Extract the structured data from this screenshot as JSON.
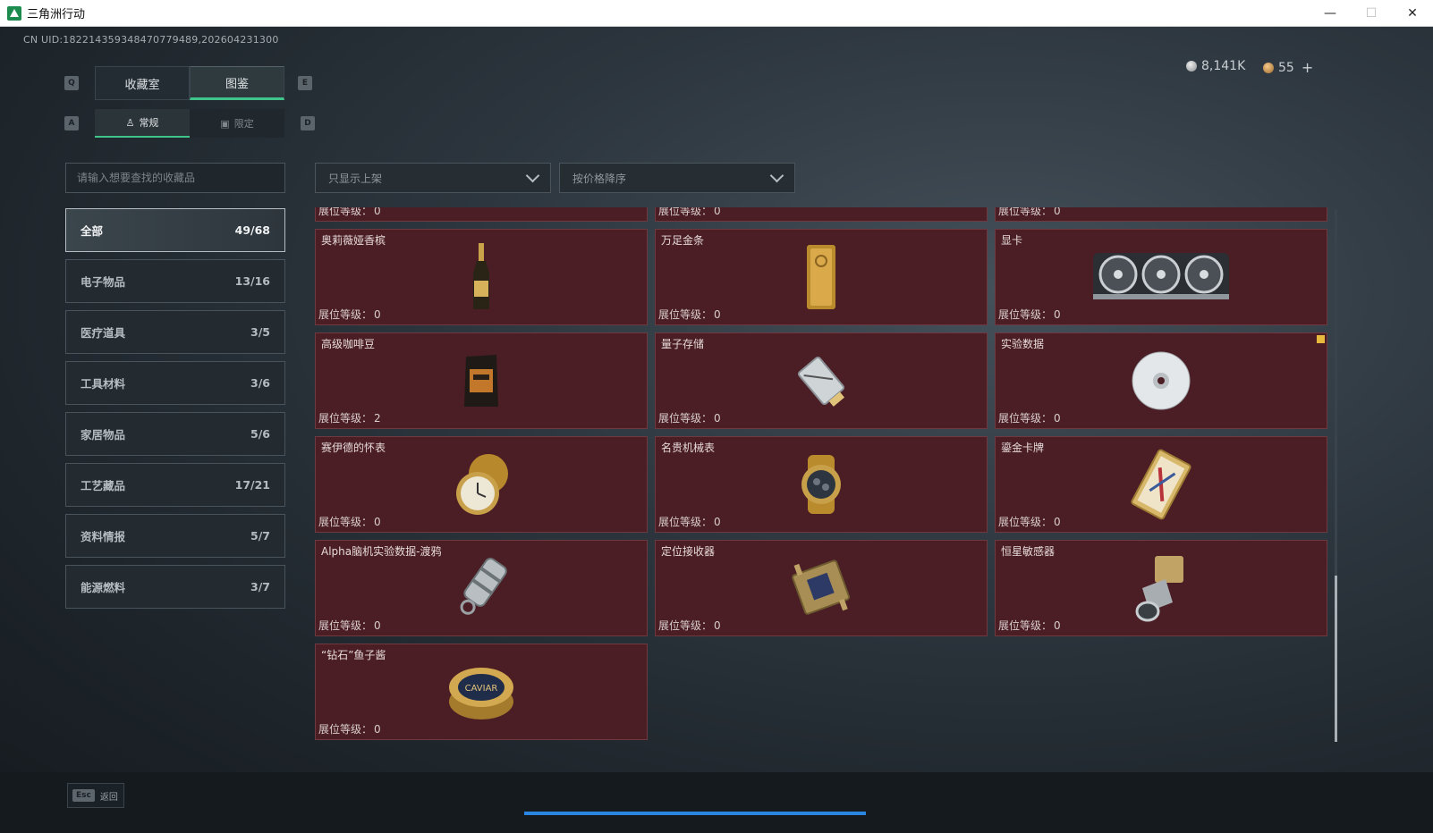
{
  "window": {
    "title": "三角洲行动",
    "minimize": "—",
    "maximize": "☐",
    "close": "✕"
  },
  "uid_text": "CN UID:182214359348470779489,202604231300",
  "currency": {
    "silver": "8,141K",
    "gold": "55",
    "add": "+"
  },
  "keys": {
    "q": "Q",
    "e": "E",
    "a": "A",
    "d": "D"
  },
  "main_tabs": [
    {
      "label": "收藏室"
    },
    {
      "label": "图鉴"
    }
  ],
  "sub_tabs": [
    {
      "label": "常规",
      "icon": "figure-icon"
    },
    {
      "label": "限定",
      "icon": "frame-icon"
    }
  ],
  "search": {
    "placeholder": "请输入想要查找的收藏品"
  },
  "filters": {
    "display": "只显示上架",
    "sort": "按价格降序"
  },
  "categories": [
    {
      "label": "全部",
      "count": "49/68"
    },
    {
      "label": "电子物品",
      "count": "13/16"
    },
    {
      "label": "医疗道具",
      "count": "3/5"
    },
    {
      "label": "工具材料",
      "count": "3/6"
    },
    {
      "label": "家居物品",
      "count": "5/6"
    },
    {
      "label": "工艺藏品",
      "count": "17/21"
    },
    {
      "label": "资料情报",
      "count": "5/7"
    },
    {
      "label": "能源燃料",
      "count": "3/7"
    }
  ],
  "level_label": "展位等级：",
  "partial_levels": [
    "0",
    "0",
    "0"
  ],
  "items": [
    {
      "name": "奥莉薇娅香槟",
      "level": "0",
      "icon": "champagne-icon"
    },
    {
      "name": "万足金条",
      "level": "0",
      "icon": "gold-bar-icon"
    },
    {
      "name": "显卡",
      "level": "0",
      "icon": "graphics-card-icon"
    },
    {
      "name": "高级咖啡豆",
      "level": "2",
      "icon": "coffee-bag-icon"
    },
    {
      "name": "量子存储",
      "level": "0",
      "icon": "usb-drive-icon"
    },
    {
      "name": "实验数据",
      "level": "0",
      "icon": "disc-icon"
    },
    {
      "name": "赛伊德的怀表",
      "level": "0",
      "icon": "pocket-watch-icon"
    },
    {
      "name": "名贵机械表",
      "level": "0",
      "icon": "wristwatch-icon"
    },
    {
      "name": "鎏金卡牌",
      "level": "0",
      "icon": "gilded-card-icon"
    },
    {
      "name": "Alpha脑机实验数据-渡鸦",
      "level": "0",
      "icon": "data-canister-icon"
    },
    {
      "name": "定位接收器",
      "level": "0",
      "icon": "gps-receiver-icon"
    },
    {
      "name": "恒星敏感器",
      "level": "0",
      "icon": "star-sensor-icon"
    },
    {
      "name": "“钻石”鱼子酱",
      "level": "0",
      "icon": "caviar-tin-icon"
    }
  ],
  "caviar_label": "CAVIAR",
  "footer": {
    "esc_key": "Esc",
    "esc_label": "返回"
  },
  "colors": {
    "accent": "#3fc48a",
    "card_bg": "#4a1e24",
    "highlight": "#e7b93c",
    "progress": "#2a86e0"
  }
}
